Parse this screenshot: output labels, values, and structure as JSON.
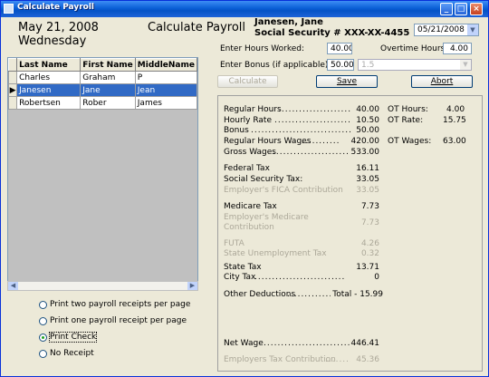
{
  "window": {
    "title": "Calculate Payroll",
    "buttons": [
      "_",
      "□",
      "×"
    ]
  },
  "header": {
    "date": "May 21, 2008",
    "weekday": "Wednesday",
    "heading": "Calculate Payroll",
    "employee_name": "Janesen, Jane",
    "ssn": "Social Security # XXX-XX-4455",
    "date_field": "05/21/2008"
  },
  "form": {
    "hours_label": "Enter Hours Worked:",
    "hours_value": "40.00",
    "overtime_label": "Overtime Hours:",
    "overtime_value": "4.00",
    "bonus_label": "Enter Bonus (if applicable)",
    "bonus_value": "50.00",
    "rate_combo": "1.5"
  },
  "buttons": {
    "calculate": "Calculate",
    "save": "Save",
    "abort": "Abort"
  },
  "grid": {
    "columns": [
      "Last Name",
      "First Name",
      "MiddleName"
    ],
    "rows": [
      {
        "last": "Charles",
        "first": "Graham",
        "middle": "P",
        "selected": false
      },
      {
        "last": "Janesen",
        "first": "Jane",
        "middle": "Jean",
        "selected": true
      },
      {
        "last": "Robertsen",
        "first": "Rober",
        "middle": "James",
        "selected": false
      }
    ]
  },
  "receipt_options": [
    {
      "label": "Print two payroll receipts per page",
      "checked": false
    },
    {
      "label": "Print one payroll receipt per page",
      "checked": false
    },
    {
      "label": "Print Check",
      "checked": true
    },
    {
      "label": "No Receipt",
      "checked": false
    }
  ],
  "summary": {
    "regular_hours": {
      "label": "Regular Hours",
      "value": "40.00"
    },
    "hourly_rate": {
      "label": "Hourly Rate",
      "value": "10.50"
    },
    "bonus": {
      "label": "Bonus",
      "value": "50.00"
    },
    "regular_wages": {
      "label": "Regular Hours Wages",
      "value": "420.00"
    },
    "gross_wages": {
      "label": "Gross Wages",
      "value": "533.00"
    },
    "federal_tax": {
      "label": "Federal Tax",
      "value": "16.11"
    },
    "social_security": {
      "label": "Social Security Tax:",
      "value": "33.05"
    },
    "employer_fica": {
      "label": "Employer's FICA Contribution",
      "value": "33.05"
    },
    "medicare": {
      "label": "Medicare Tax",
      "value": "7.73"
    },
    "employer_medicare_line1": "Employer's Medicare",
    "employer_medicare_line2": "Contribution",
    "employer_medicare_value": "7.73",
    "futa": {
      "label": "FUTA",
      "value": "4.26"
    },
    "state_unemployment": {
      "label": "State Unemployment Tax",
      "value": "0.32"
    },
    "state_tax": {
      "label": "State Tax",
      "value": "13.71"
    },
    "city_tax": {
      "label": "City Tax",
      "value": "0"
    },
    "other_deductions": {
      "label": "Other Deductions",
      "value": "Total - 15.99"
    },
    "net_wage": {
      "label": "Net Wage",
      "value": "446.41"
    },
    "employer_tax": {
      "label": "Employers Tax Contribution",
      "value": "45.36"
    },
    "ot_hours": {
      "label": "OT Hours:",
      "value": "4.00"
    },
    "ot_rate": {
      "label": "OT Rate:",
      "value": "15.75"
    },
    "ot_wages": {
      "label": "OT Wages:",
      "value": "63.00"
    }
  },
  "colors": {
    "titlebar": "#0a5fd6",
    "selection": "#316ac5",
    "window_bg": "#ece9d8"
  }
}
